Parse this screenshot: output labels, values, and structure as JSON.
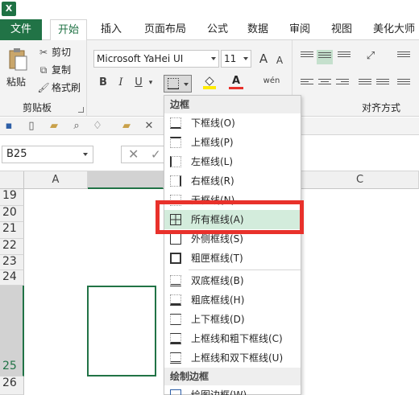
{
  "app": {
    "logo": "X"
  },
  "ribbon_tabs": [
    "文件",
    "开始",
    "插入",
    "页面布局",
    "公式",
    "数据",
    "审阅",
    "视图",
    "美化大师"
  ],
  "clipboard": {
    "paste": "粘贴",
    "cut": "剪切",
    "copy": "复制",
    "format_painter": "格式刷",
    "group_label": "剪贴板"
  },
  "font": {
    "name": "Microsoft YaHei UI",
    "size": "11",
    "bold": "B",
    "italic": "I",
    "underline": "U",
    "grow": "A",
    "shrink": "A",
    "phonetic": "wén"
  },
  "alignment": {
    "group_label": "对齐方式"
  },
  "namebox": {
    "value": "B25"
  },
  "columns": [
    "A",
    "C"
  ],
  "rows": [
    "19",
    "20",
    "21",
    "22",
    "23",
    "24",
    "25",
    "26"
  ],
  "border_menu": {
    "section1": "边框",
    "items": [
      "下框线(O)",
      "上框线(P)",
      "左框线(L)",
      "右框线(R)",
      "无框线(N)",
      "所有框线(A)",
      "外侧框线(S)",
      "粗匣框线(T)",
      "双底框线(B)",
      "粗底框线(H)",
      "上下框线(D)",
      "上框线和粗下框线(C)",
      "上框线和双下框线(U)"
    ],
    "section2": "绘制边框",
    "draw_item": "绘图边框(W)",
    "highlighted_index": 5
  },
  "colors": {
    "accent": "#217346",
    "highlight": "#d3ecdc",
    "annotation": "#e8312b"
  }
}
